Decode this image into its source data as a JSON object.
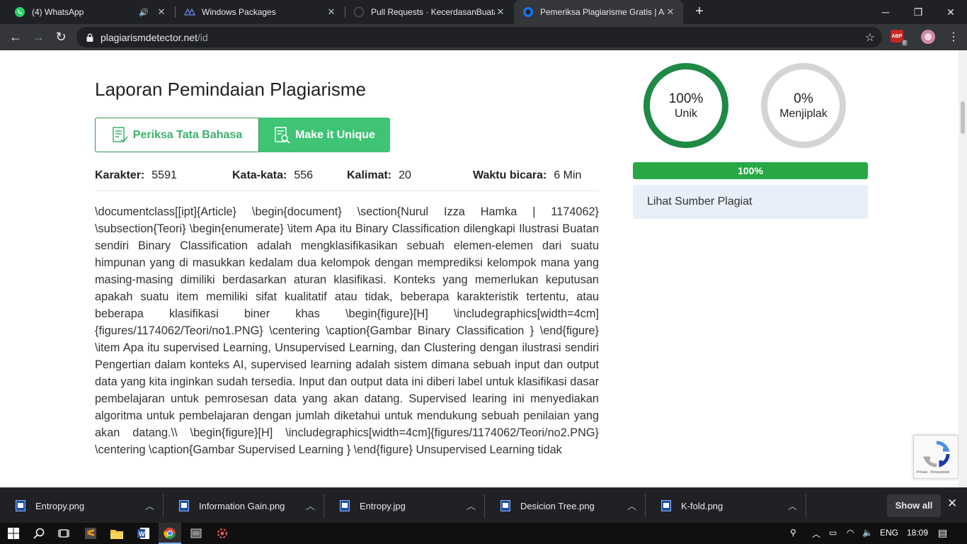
{
  "browser": {
    "tabs": [
      {
        "title": "(4) WhatsApp",
        "icon": "whatsapp-icon",
        "audio_icon": "speaker-icon"
      },
      {
        "title": "Windows Packages",
        "icon": "windows-packages-icon"
      },
      {
        "title": "Pull Requests · KecerdasanBuatan",
        "icon": "github-icon"
      },
      {
        "title": "Pemeriksa Plagiarisme Gratis | Akurat",
        "icon": "site-icon",
        "active": true
      }
    ],
    "url_domain": "plagiarismdetector.net",
    "url_path": "/id",
    "extension_badge": "8"
  },
  "report": {
    "title": "Laporan Pemindaian Plagiarisme",
    "grammar_button": "Periksa Tata Bahasa",
    "unique_button": "Make it Unique",
    "stats": {
      "chars_label": "Karakter:",
      "chars_value": "5591",
      "words_label": "Kata-kata:",
      "words_value": "556",
      "sentences_label": "Kalimat:",
      "sentences_value": "20",
      "time_label": "Waktu bicara:",
      "time_value": "6 Min"
    },
    "content": "\\documentclass[[ipt]{Article} \\begin{document} \\section{Nurul Izza Hamka | 1174062} \\subsection{Teori} \\begin{enumerate} \\item Apa itu Binary Classification dilengkapi Ilustrasi Buatan sendiri Binary Classification adalah mengklasifikasikan sebuah elemen-elemen dari suatu himpunan yang di masukkan kedalam dua kelompok dengan memprediksi kelompok mana yang masing-masing dimiliki berdasarkan aturan klasifikasi. Konteks yang memerlukan keputusan apakah suatu item memiliki sifat kualitatif atau tidak, beberapa karakteristik tertentu, atau beberapa klasifikasi biner khas \\begin{figure}[H] \\includegraphics[width=4cm]{figures/1174062/Teori/no1.PNG} \\centering \\caption{Gambar Binary Classification } \\end{figure} \\item Apa itu supervised Learning, Unsupervised Learning, dan Clustering dengan ilustrasi sendiri Pengertian dalam konteks AI, supervised learning adalah sistem dimana sebuah input dan output data yang kita inginkan sudah tersedia. Input dan output data ini diberi label untuk klasifikasi dasar pembelajaran untuk pemrosesan data yang akan datang. Supervised learing ini menyediakan algoritma untuk pembelajaran dengan jumlah diketahui untuk mendukung sebuah penilaian yang akan datang.\\\\ \\begin{figure}[H] \\includegraphics[width=4cm]{figures/1174062/Teori/no2.PNG} \\centering \\caption{Gambar Supervised Learning } \\end{figure} Unsupervised Learning tidak"
  },
  "results": {
    "unique_value": "100%",
    "unique_label": "Unik",
    "unique_percent": 100,
    "plagiarized_value": "0%",
    "plagiarized_label": "Menjiplak",
    "progress_text": "100%",
    "view_sources": "Lihat Sumber Plagiat"
  },
  "recaptcha_text": "Privasi - Persyaratan",
  "downloads": {
    "items": [
      "Entropy.png",
      "Information Gain.png",
      "Entropy.jpg",
      "Desicion Tree.png",
      "K-fold.png"
    ],
    "show_all": "Show all"
  },
  "taskbar": {
    "language": "ENG",
    "time": "18:09"
  },
  "colors": {
    "accent_green": "#3ec474",
    "gauge_green": "#1e8a45",
    "progress_green": "#28a745",
    "chrome_dark": "#202124"
  }
}
